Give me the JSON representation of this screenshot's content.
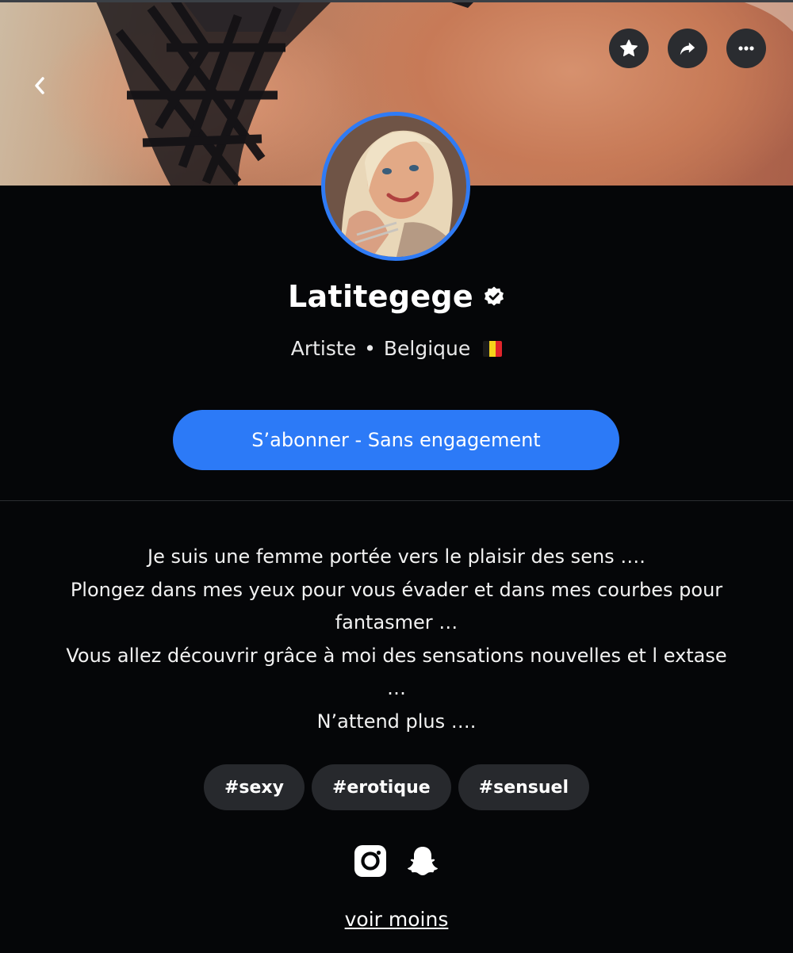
{
  "header": {
    "back_icon": "chevron-left-icon",
    "actions": [
      {
        "name": "favorite",
        "icon": "star-icon"
      },
      {
        "name": "share",
        "icon": "share-arrow-icon"
      },
      {
        "name": "more",
        "icon": "more-dots-icon"
      }
    ]
  },
  "profile": {
    "name": "Latitegege",
    "verified_icon": "verified-badge-icon",
    "category": "Artiste",
    "separator": "•",
    "country": "Belgique",
    "flag_colors": [
      "#1a1a1a",
      "#f5d31b",
      "#e0252b"
    ]
  },
  "subscribe_label": "S’abonner - Sans engagement",
  "bio": [
    "Je suis une femme portée vers le plaisir des sens ….",
    "Plongez dans mes yeux pour vous évader et dans mes courbes pour",
    "fantasmer …",
    "Vous allez découvrir grâce à moi des sensations nouvelles et l extase",
    "…",
    "N’attend plus …."
  ],
  "tags": [
    "#sexy",
    "#erotique",
    "#sensuel"
  ],
  "socials": [
    {
      "name": "instagram",
      "icon": "instagram-icon"
    },
    {
      "name": "snapchat",
      "icon": "snapchat-icon"
    }
  ],
  "see_less_label": "voir moins",
  "colors": {
    "accent": "#2c7af7",
    "background": "#050608",
    "chip": "#27292d",
    "avatar_ring": "#2f7bf5"
  }
}
